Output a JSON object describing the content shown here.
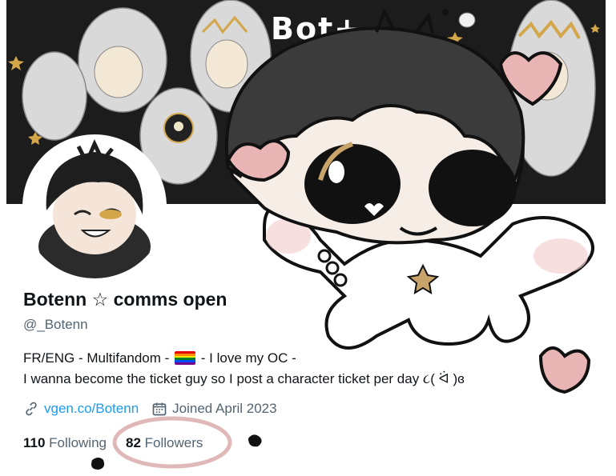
{
  "banner": {
    "text": "Bot+"
  },
  "profile": {
    "display_name": "Botenn ☆ comms open",
    "handle": "@_Botenn",
    "bio_line1_before": "FR/ENG - Multifandom -",
    "bio_line1_after": "- I love my OC -",
    "bio_line2": "I wanna become the ticket guy so I post a character ticket per day ૮( ᐛ )ɞ",
    "website": "vgen.co/Botenn",
    "joined": "Joined April 2023",
    "following_count": "110",
    "following_label": "Following",
    "followers_count": "82",
    "followers_label": "Followers"
  },
  "colors": {
    "link": "#1d9bf0",
    "secondary_text": "#536471",
    "primary_text": "#0f1419",
    "drawing_outline": "#111111",
    "blush_pink": "#e8b4b4",
    "hair_dark": "#3a3a3a"
  },
  "icons": {
    "link": "link-icon",
    "calendar": "calendar-icon",
    "flag": "rainbow-flag-emoji"
  }
}
